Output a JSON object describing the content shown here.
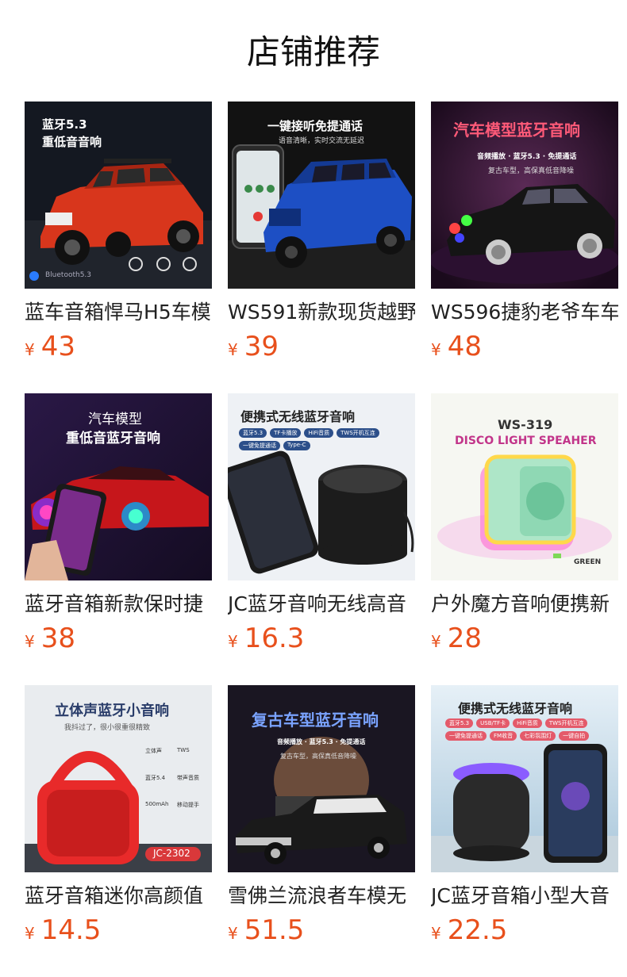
{
  "page_title": "店铺推荐",
  "products": [
    {
      "name": "蓝车音箱悍马H5车模",
      "currency": "¥",
      "price": "43",
      "image": {
        "line1": "蓝牙5.3",
        "line2": "重低音音响",
        "footer": "Bluetooth5.3",
        "colors": {
          "bg": "#14171f",
          "body": "#d8361c"
        }
      }
    },
    {
      "name": "WS591新款现货越野",
      "currency": "¥",
      "price": "39",
      "image": {
        "line1": "一键接听免提通话",
        "line2": "语音清晰，实时交流无延迟",
        "colors": {
          "bg": "#141414",
          "body": "#1d4fc4"
        }
      }
    },
    {
      "name": "WS596捷豹老爷车车",
      "currency": "¥",
      "price": "48",
      "image": {
        "line1": "汽车模型蓝牙音响",
        "line2": "音频播放 · 蓝牙5.3 · 免提通话",
        "line3": "复古车型，高保真低音降噪",
        "colors": {
          "bg": "#2a0f28",
          "body": "#151515",
          "accent": "#ff4d6d"
        }
      }
    },
    {
      "name": "蓝牙音箱新款保时捷",
      "currency": "¥",
      "price": "38",
      "image": {
        "line1": "汽车模型",
        "line2": "重低音蓝牙音响",
        "colors": {
          "bg": "#1d1230",
          "body": "#c6161b"
        }
      }
    },
    {
      "name": "JC蓝牙音响无线高音",
      "currency": "¥",
      "price": "16.3",
      "image": {
        "line1": "便携式无线蓝牙音响",
        "tags": [
          "蓝牙5.3",
          "TF卡播放",
          "HiFi音质",
          "TWS开机互连",
          "一键免提通话",
          "Type-C"
        ],
        "colors": {
          "bg": "#eef1f5",
          "body": "#1a1a1a"
        }
      }
    },
    {
      "name": "户外魔方音响便携新",
      "currency": "¥",
      "price": "28",
      "image": {
        "line1": "WS-319",
        "line2": "DISCO LIGHT SPEAHER",
        "footer": "GREEN",
        "colors": {
          "bg": "#f6f7f2",
          "body": "#aee6c8"
        }
      }
    },
    {
      "name": "蓝牙音箱迷你高颜值",
      "currency": "¥",
      "price": "14.5",
      "image": {
        "line1": "立体声蓝牙小音响",
        "line2": "我抖过了，很小很重很精致",
        "footer": "JC-2302",
        "features": [
          "立体声",
          "TWS",
          "蓝牙5.4",
          "带声音质",
          "500mAh",
          "移动提手"
        ],
        "colors": {
          "bg": "#e9ecef",
          "body": "#e82a2a"
        }
      }
    },
    {
      "name": "雪佛兰流浪者车模无",
      "currency": "¥",
      "price": "51.5",
      "image": {
        "line1": "复古车型蓝牙音响",
        "line2": "音频播放 · 蓝牙5.3 · 免提通话",
        "line3": "复古车型，高保真低音降噪",
        "colors": {
          "bg": "#1a1622",
          "body": "#1a1a1a",
          "accent": "#6f9bff"
        }
      }
    },
    {
      "name": "JC蓝牙音箱小型大音",
      "currency": "¥",
      "price": "22.5",
      "image": {
        "line1": "便携式无线蓝牙音响",
        "tags": [
          "蓝牙5.3",
          "USB/TF卡",
          "HiFi音质",
          "TWS开机互连",
          "一键免提通话",
          "FM收音",
          "七彩氛围灯",
          "一键自拍"
        ],
        "colors": {
          "bg": "#d7e7f2",
          "body": "#2a2a2a"
        }
      }
    }
  ]
}
